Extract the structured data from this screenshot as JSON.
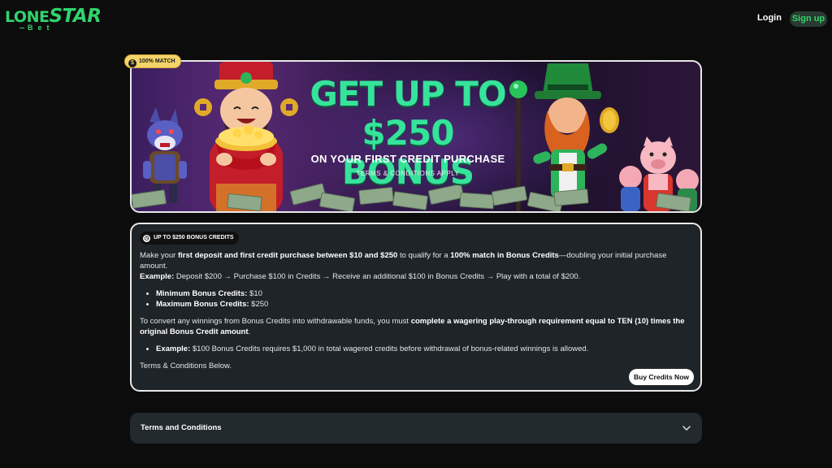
{
  "logo": {
    "part1": "LONE",
    "part2": "STAR",
    "sub": "Bet"
  },
  "nav": {
    "login": "Login",
    "signup": "Sign up"
  },
  "banner": {
    "badge": "100% MATCH",
    "badge_icon": "dollar-coin-icon",
    "headline_line1": "GET UP TO",
    "headline_line2": "$250 BONUS",
    "subheadline": "ON YOUR FIRST CREDIT PURCHASE",
    "terms": "TERMS & CONDITIONS APPLY"
  },
  "card": {
    "chip_label": "UP TO $250 BONUS CREDITS",
    "chip_icon": "clock-icon",
    "p1_a": "Make your ",
    "p1_b": "first deposit and first credit purchase between $10 and $250",
    "p1_c": " to qualify for a ",
    "p1_d": "100% match in Bonus Credits",
    "p1_e": "—doubling your initial purchase amount.",
    "example_label": "Example:",
    "example_text": " Deposit $200 → Purchase $100 in Credits → Receive an additional $100 in Bonus Credits → Play with a total of $200.",
    "min_label": "Minimum Bonus Credits:",
    "min_value": " $10",
    "max_label": "Maximum Bonus Credits:",
    "max_value": " $250",
    "p2_a": "To convert any winnings from Bonus Credits into withdrawable funds, you must ",
    "p2_b": "complete a wagering play-through requirement equal to TEN (10) times the original Bonus Credit amount",
    "p2_c": ".",
    "ex2_label": "Example:",
    "ex2_text": " $100 Bonus Credits requires $1,000 in total wagered credits before withdrawal of bonus-related winnings is allowed.",
    "terms_below": "Terms & Conditions Below.",
    "buy_button": "Buy Credits Now"
  },
  "accordion": {
    "label": "Terms and Conditions",
    "icon": "chevron-down-icon"
  },
  "colors": {
    "brand_green": "#31d36d",
    "headline_green": "#35e39a",
    "badge_gold": "#f3d36a",
    "card_bg": "#1e2428",
    "page_bg": "#0c0c0c"
  }
}
